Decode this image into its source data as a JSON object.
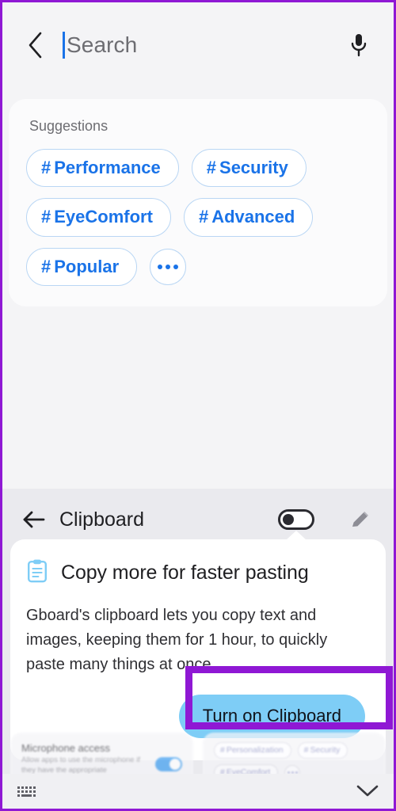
{
  "search": {
    "back_icon": "chevron-left-icon",
    "placeholder": "Search",
    "mic_icon": "microphone-icon"
  },
  "suggestions": {
    "title": "Suggestions",
    "more_icon": "ellipsis-icon",
    "chips": [
      {
        "hash": "#",
        "label": "Performance"
      },
      {
        "hash": "#",
        "label": "Security"
      },
      {
        "hash": "#",
        "label": "EyeComfort"
      },
      {
        "hash": "#",
        "label": "Advanced"
      },
      {
        "hash": "#",
        "label": "Popular"
      }
    ]
  },
  "clipboard": {
    "back_icon": "arrow-left-icon",
    "title": "Clipboard",
    "toggle_state": "off",
    "edit_icon": "pencil-icon",
    "card": {
      "icon": "clipboard-icon",
      "title": "Copy more for faster pasting",
      "body": "Gboard's clipboard lets you copy text and images, keeping them for 1 hour, to quickly paste many things at once.",
      "button_label": "Turn on Clipboard"
    }
  },
  "background": {
    "microphone": {
      "title": "Microphone access",
      "subtitle": "Allow apps to use the microphone if they have the appropriate permissions.",
      "toggle_state": "on"
    },
    "chips": [
      {
        "hash": "#",
        "label": "Personalization"
      },
      {
        "hash": "#",
        "label": "Security"
      },
      {
        "hash": "#",
        "label": "EyeComfort"
      }
    ],
    "more_icon": "ellipsis-icon"
  },
  "bottom_nav": {
    "keyboard_icon": "keyboard-icon",
    "collapse_icon": "chevron-down-icon"
  },
  "colors": {
    "accent_blue": "#1a73e8",
    "chip_border": "#b9d6f4",
    "button_blue": "#7ecdf6",
    "annotation_purple": "#8f18d4",
    "clipboard_icon_blue": "#7ecdf6"
  }
}
